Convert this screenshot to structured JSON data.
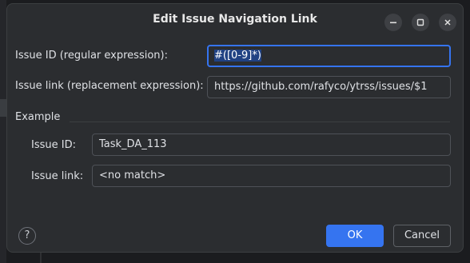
{
  "dialog": {
    "title": "Edit Issue Navigation Link"
  },
  "window_controls": {
    "minimize_icon": "minimize-icon",
    "maximize_icon": "maximize-icon",
    "close_icon": "close-icon"
  },
  "form": {
    "issue_id_label": "Issue ID (regular expression):",
    "issue_id_value": "#([0-9]*)",
    "issue_link_label": "Issue link (replacement expression):",
    "issue_link_value": "https://github.com/rafyco/ytrss/issues/$1"
  },
  "example": {
    "section_label": "Example",
    "issue_id_label": "Issue ID:",
    "issue_id_value": "Task_DA_113",
    "issue_link_label": "Issue link:",
    "issue_link_value": "<no match>"
  },
  "footer": {
    "help_glyph": "?",
    "ok_label": "OK",
    "cancel_label": "Cancel"
  },
  "colors": {
    "accent": "#3574f0",
    "dialog_bg": "#2b2d30",
    "text": "#dfe1e5"
  }
}
